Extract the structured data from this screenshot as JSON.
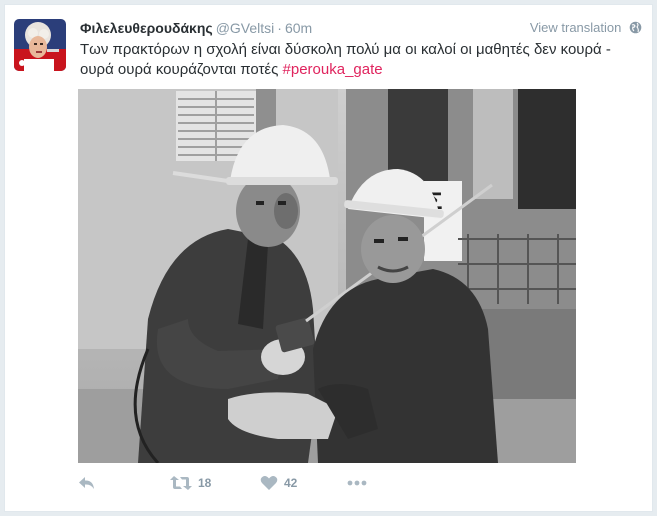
{
  "tweet": {
    "fullname": "Φιλελευθερουδάκης",
    "username": "@GVeltsi",
    "separator": "·",
    "time": "60m",
    "view_translation": "View translation",
    "text_part1": "Των πρακτόρων η σχολή είναι δύσκολη πολύ μα οι καλοί οι μαθητές δεν κουρά - ουρά ουρά κουράζονται ποτές ",
    "hashtag": "#perouka_gate"
  },
  "actions": {
    "reply_icon": "reply-icon",
    "retweet_icon": "retweet-icon",
    "retweet_count": "18",
    "like_icon": "heart-icon",
    "like_count": "42",
    "more_icon": "more-icon"
  },
  "colors": {
    "hashtag": "#e0245e",
    "secondary_text": "#8899a6",
    "background": "#e6ecf0"
  }
}
